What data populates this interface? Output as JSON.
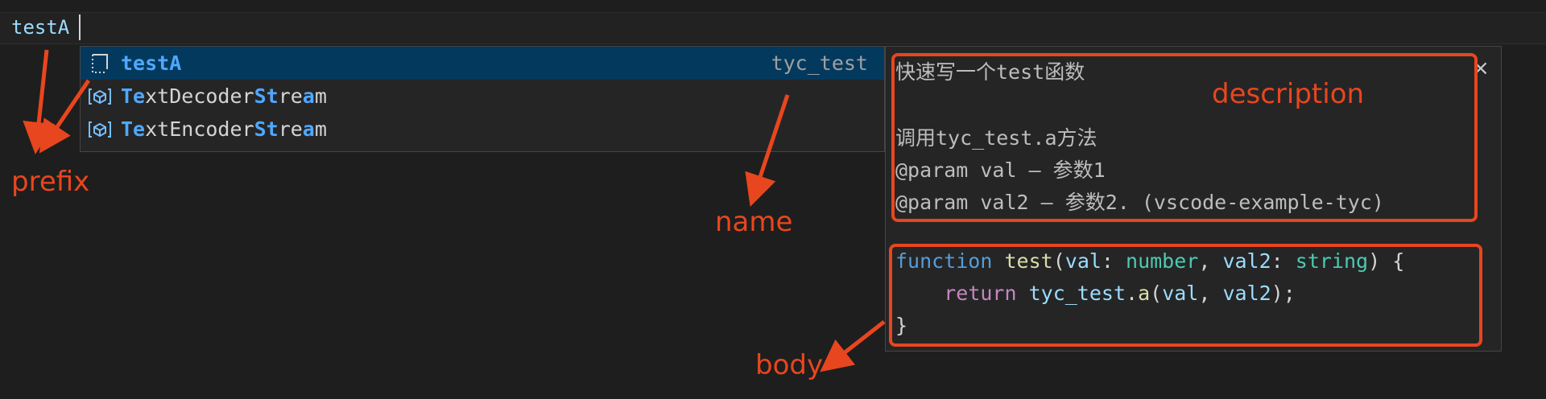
{
  "editor": {
    "typed_text": "testA"
  },
  "suggest": {
    "items": [
      {
        "label": "testA",
        "detail": "tyc_test",
        "icon": "snippet-icon",
        "selected": true
      },
      {
        "label_parts": [
          "Te",
          "xtDecoder",
          "St",
          "re",
          "a",
          "m"
        ],
        "label": "TextDecoderStream",
        "icon": "class-icon"
      },
      {
        "label_parts": [
          "Te",
          "xtEncoder",
          "St",
          "re",
          "a",
          "m"
        ],
        "label": "TextEncoderStream",
        "icon": "class-icon"
      }
    ]
  },
  "details": {
    "close_glyph": "×",
    "lines": [
      "快速写一个test函数",
      "调用tyc_test.a方法",
      "@param val — 参数1",
      "@param val2 — 参数2. (vscode-example-tyc)"
    ],
    "code": {
      "line1": {
        "kw": "function",
        "fn": "test",
        "p1": "val",
        "t1": "number",
        "p2": "val2",
        "t2": "string"
      },
      "line2": {
        "kw": "return",
        "obj": "tyc_test",
        "fn": "a",
        "a1": "val",
        "a2": "val2"
      },
      "line3": "}"
    }
  },
  "annotations": {
    "prefix": "prefix",
    "name": "name",
    "description": "description",
    "body": "body",
    "color": "#e8461e"
  }
}
